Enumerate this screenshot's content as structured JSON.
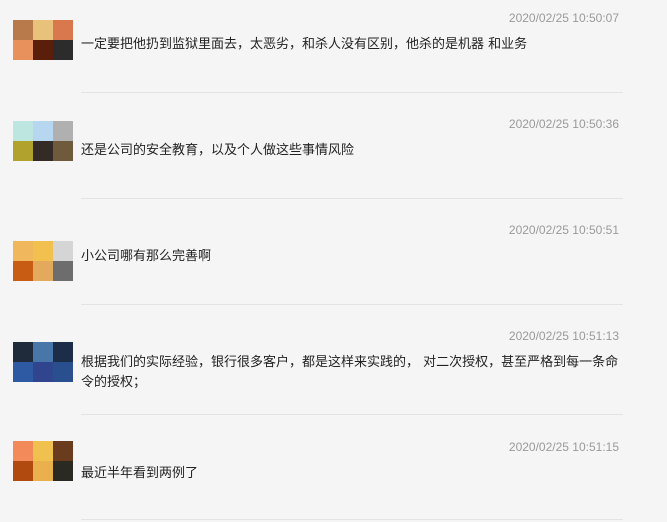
{
  "messages": [
    {
      "time": "2020/02/25 10:50:07",
      "text": "一定要把他扔到监狱里面去，太恶劣，和杀人没有区别，他杀的是机器 和业务",
      "avatar_colors": [
        "#b97a4b",
        "#e8c27a",
        "#d9774d",
        "#e8915c",
        "#5b1e0a",
        "#2c2c2c"
      ]
    },
    {
      "time": "2020/02/25 10:50:36",
      "text": "还是公司的安全教育，以及个人做这些事情风险",
      "avatar_colors": [
        "#bde6e0",
        "#b7d6ef",
        "#b0b0b0",
        "#b0a22c",
        "#342a26",
        "#6f5a3b"
      ]
    },
    {
      "time": "2020/02/25 10:50:51",
      "text": "小公司哪有那么完善啊",
      "avatar_colors": [
        "#f0b75c",
        "#f2c04e",
        "#d5d5d5",
        "#c85c12",
        "#e3a95c",
        "#6d6d6d"
      ]
    },
    {
      "time": "2020/02/25 10:51:13",
      "text": "根据我们的实际经验，银行很多客户，都是这样来实践的， 对二次授权，甚至严格到每一条命令的授权；",
      "avatar_colors": [
        "#1f2b3b",
        "#4876a9",
        "#1c2d48",
        "#2e5aa3",
        "#30458e",
        "#2a4f8f"
      ]
    },
    {
      "time": "2020/02/25 10:51:15",
      "text": "最近半年看到两例了",
      "avatar_colors": [
        "#f28a5a",
        "#f1c14f",
        "#6a3b1c",
        "#b04a0e",
        "#e9b04d",
        "#2b2a22"
      ]
    }
  ]
}
